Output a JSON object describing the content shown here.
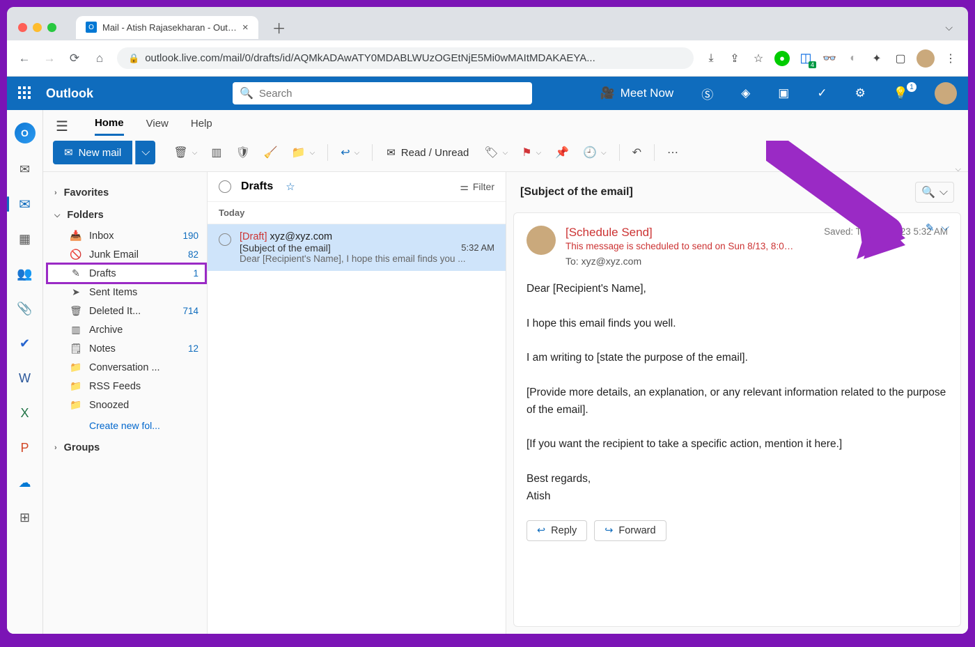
{
  "browser": {
    "tab_title": "Mail - Atish Rajasekharan - Out…",
    "url": "outlook.live.com/mail/0/drafts/id/AQMkADAwATY0MDABLWUzOGEtNjE5Mi0wMAItMDAKAEYA..."
  },
  "header": {
    "brand": "Outlook",
    "search_placeholder": "Search",
    "meet_now": "Meet Now",
    "bell_badge": "1"
  },
  "ribbon": {
    "tabs": {
      "home": "Home",
      "view": "View",
      "help": "Help"
    },
    "new_mail": "New mail",
    "read_unread": "Read / Unread"
  },
  "folders": {
    "favorites": "Favorites",
    "folders_label": "Folders",
    "groups": "Groups",
    "create": "Create new fol...",
    "items": {
      "inbox": {
        "label": "Inbox",
        "count": "190"
      },
      "junk": {
        "label": "Junk Email",
        "count": "82"
      },
      "drafts": {
        "label": "Drafts",
        "count": "1"
      },
      "sent": {
        "label": "Sent Items",
        "count": ""
      },
      "deleted": {
        "label": "Deleted It...",
        "count": "714"
      },
      "archive": {
        "label": "Archive",
        "count": ""
      },
      "notes": {
        "label": "Notes",
        "count": "12"
      },
      "convo": {
        "label": "Conversation ...",
        "count": ""
      },
      "rss": {
        "label": "RSS Feeds",
        "count": ""
      },
      "snoozed": {
        "label": "Snoozed",
        "count": ""
      }
    }
  },
  "msglist": {
    "folder_title": "Drafts",
    "filter": "Filter",
    "today": "Today",
    "item": {
      "draft_tag": "[Draft]",
      "to": "xyz@xyz.com",
      "subject": "[Subject of the email]",
      "time": "5:32 AM",
      "preview": "Dear [Recipient's Name], I hope this email finds you ..."
    }
  },
  "reading": {
    "subject_header": "[Subject of the email]",
    "schedule_title": "[Schedule Send]",
    "schedule_msg": "This message is scheduled to send on Sun 8/13, 8:00 A…",
    "to_label": "To:",
    "to_value": "xyz@xyz.com",
    "saved": "Saved: Tue 8/8/2023 5:32 AM",
    "body": "Dear [Recipient's Name],\n\nI hope this email finds you well.\n\nI am writing to [state the purpose of the email].\n\n[Provide more details, an explanation, or any relevant information related to the purpose of the email].\n\n[If you want the recipient to take a specific action, mention it here.]\n\nBest regards,\nAtish",
    "reply": "Reply",
    "forward": "Forward"
  }
}
